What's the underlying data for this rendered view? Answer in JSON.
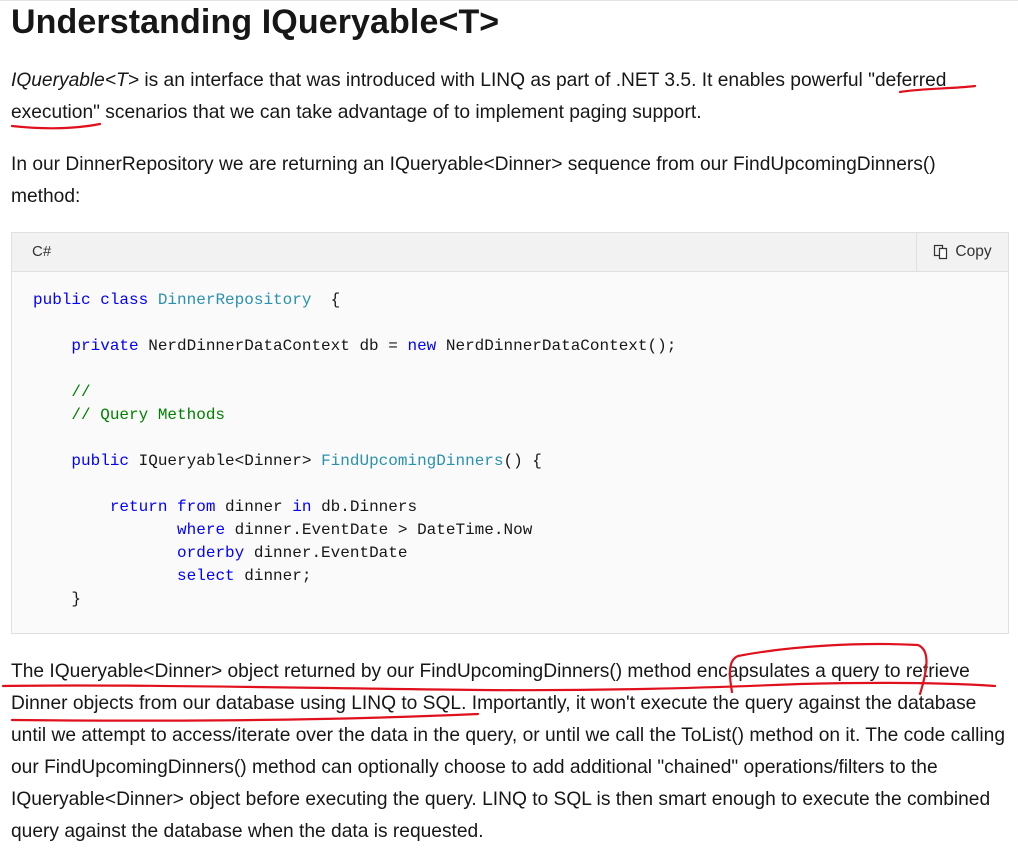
{
  "article": {
    "title": "Understanding IQueryable<T>",
    "p1": {
      "term": "IQueryable<T>",
      "text_before_highlight": " is an interface that was introduced with LINQ as part of .NET 3.5. It enables powerful ",
      "highlight": "\"deferred execution\"",
      "text_after_highlight": " scenarios that we can take advantage of to implement paging support."
    },
    "p2": "In our DinnerRepository we are returning an IQueryable<Dinner> sequence from our FindUpcomingDinners() method:",
    "p3": {
      "part1": "The IQueryable<Dinner> object returned by our FindUpcomingDinners() method ",
      "part2": "encapsulates a query",
      "part3": " to retrieve Dinner objects from our database using LINQ to SQL.",
      "part4": " Importantly, it won't execute the query against the database until we attempt to access/iterate over the data in the query, or until we call the ToList() method on it. The code calling our FindUpcomingDinners() method can optionally choose to add additional \"chained\" operations/filters to the IQueryable<Dinner> object before executing the query. LINQ to SQL is then smart enough to execute the combined query against the database when the data is requested."
    }
  },
  "code_block": {
    "language": "C#",
    "copy_label": "Copy",
    "lines": [
      [
        [
          "kw",
          "public class "
        ],
        [
          "ty",
          "DinnerRepository"
        ],
        [
          "",
          "  {"
        ]
      ],
      [],
      [
        [
          "",
          "    "
        ],
        [
          "kw",
          "private "
        ],
        [
          "",
          "NerdDinnerDataContext db = "
        ],
        [
          "kw",
          "new "
        ],
        [
          "",
          "NerdDinnerDataContext();"
        ]
      ],
      [],
      [
        [
          "",
          "    "
        ],
        [
          "cm",
          "//"
        ]
      ],
      [
        [
          "",
          "    "
        ],
        [
          "cm",
          "// Query Methods"
        ]
      ],
      [],
      [
        [
          "",
          "    "
        ],
        [
          "kw",
          "public "
        ],
        [
          "",
          "IQueryable<Dinner> "
        ],
        [
          "ty",
          "FindUpcomingDinners"
        ],
        [
          "",
          "() {"
        ]
      ],
      [],
      [
        [
          "",
          "        "
        ],
        [
          "kw",
          "return from "
        ],
        [
          "",
          "dinner "
        ],
        [
          "kw",
          "in "
        ],
        [
          "",
          "db.Dinners"
        ]
      ],
      [
        [
          "",
          "               "
        ],
        [
          "kw",
          "where "
        ],
        [
          "",
          "dinner.EventDate > DateTime.Now"
        ]
      ],
      [
        [
          "",
          "               "
        ],
        [
          "kw",
          "orderby "
        ],
        [
          "",
          "dinner.EventDate"
        ]
      ],
      [
        [
          "",
          "               "
        ],
        [
          "kw",
          "select "
        ],
        [
          "",
          "dinner;"
        ]
      ],
      [
        [
          "",
          "    }"
        ]
      ]
    ]
  },
  "annotations": {
    "ink_color": "#e0101c"
  }
}
